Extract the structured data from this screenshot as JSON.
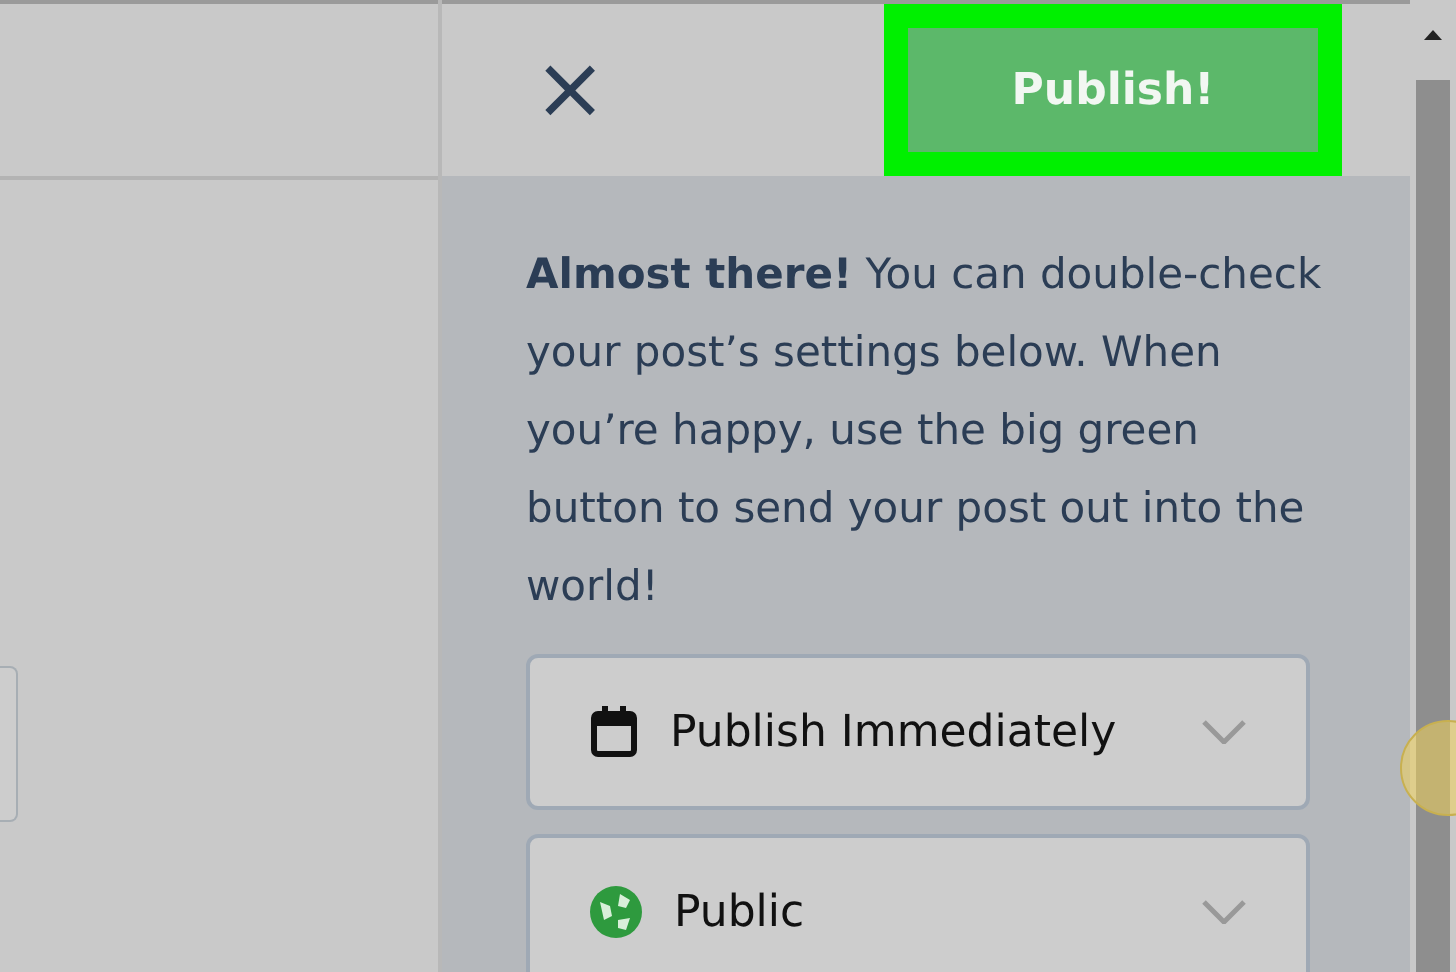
{
  "header": {
    "close_label": "×",
    "publish_button": "Publish!",
    "publish_highlighted": true
  },
  "intro": "**Almost there!** You can double-check your post’s settings below. When you’re happy, use the big green button to send your post out into the world!",
  "settings": [
    {
      "kind": "schedule",
      "label": "Publish Immediately"
    },
    {
      "kind": "visibility",
      "label": "Public"
    }
  ]
}
